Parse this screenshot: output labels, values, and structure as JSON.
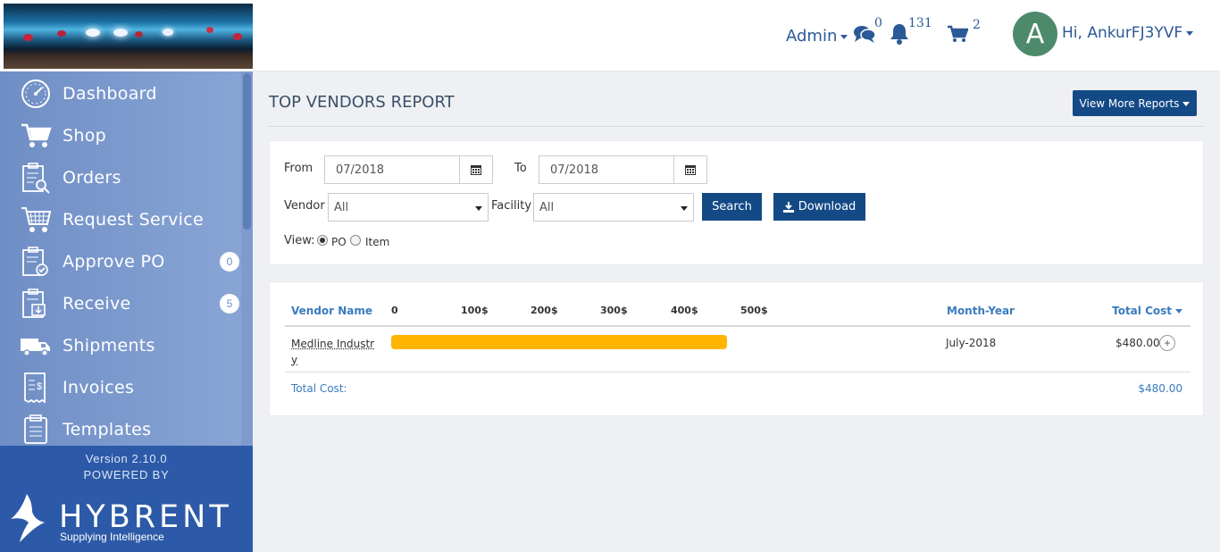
{
  "header": {
    "admin_label": "Admin",
    "messages_count": "0",
    "notifications_count": "131",
    "cart_count": "2",
    "avatar_letter": "A",
    "user_greeting": "Hi, AnkurFJ3YVF"
  },
  "sidebar": {
    "items": [
      {
        "label": "Dashboard"
      },
      {
        "label": "Shop"
      },
      {
        "label": "Orders"
      },
      {
        "label": "Request Service"
      },
      {
        "label": "Approve PO",
        "badge": "0"
      },
      {
        "label": "Receive",
        "badge": "5"
      },
      {
        "label": "Shipments"
      },
      {
        "label": "Invoices"
      },
      {
        "label": "Templates"
      }
    ],
    "version": "Version 2.10.0",
    "powered_by": "POWERED BY",
    "brand": "HYBRENT",
    "tagline": "Supplying Intelligence"
  },
  "page": {
    "title": "TOP VENDORS REPORT",
    "more_reports_label": "View More Reports"
  },
  "filters": {
    "from_label": "From",
    "from_value": "07/2018",
    "to_label": "To",
    "to_value": "07/2018",
    "vendor_label": "Vendor",
    "vendor_value": "All",
    "facility_label": "Facility",
    "facility_value": "All",
    "search_label": "Search",
    "download_label": "Download",
    "view_label": "View:",
    "view_options": [
      "PO",
      "Item"
    ],
    "view_selected": "PO"
  },
  "report": {
    "col_vendor": "Vendor Name",
    "col_month": "Month-Year",
    "col_total": "Total Cost",
    "scale_ticks": [
      "0",
      "100$",
      "200$",
      "300$",
      "400$",
      "500$"
    ],
    "rows": [
      {
        "vendor": "Medline Industry",
        "month": "July-2018",
        "total": "$480.00",
        "value": 480
      }
    ],
    "total_label": "Total Cost:",
    "total_value": "$480.00",
    "bar_color": "#ffb400"
  },
  "chart_data": {
    "type": "bar",
    "categories": [
      "Medline Industry"
    ],
    "values": [
      480
    ],
    "xlim": [
      0,
      500
    ]
  }
}
